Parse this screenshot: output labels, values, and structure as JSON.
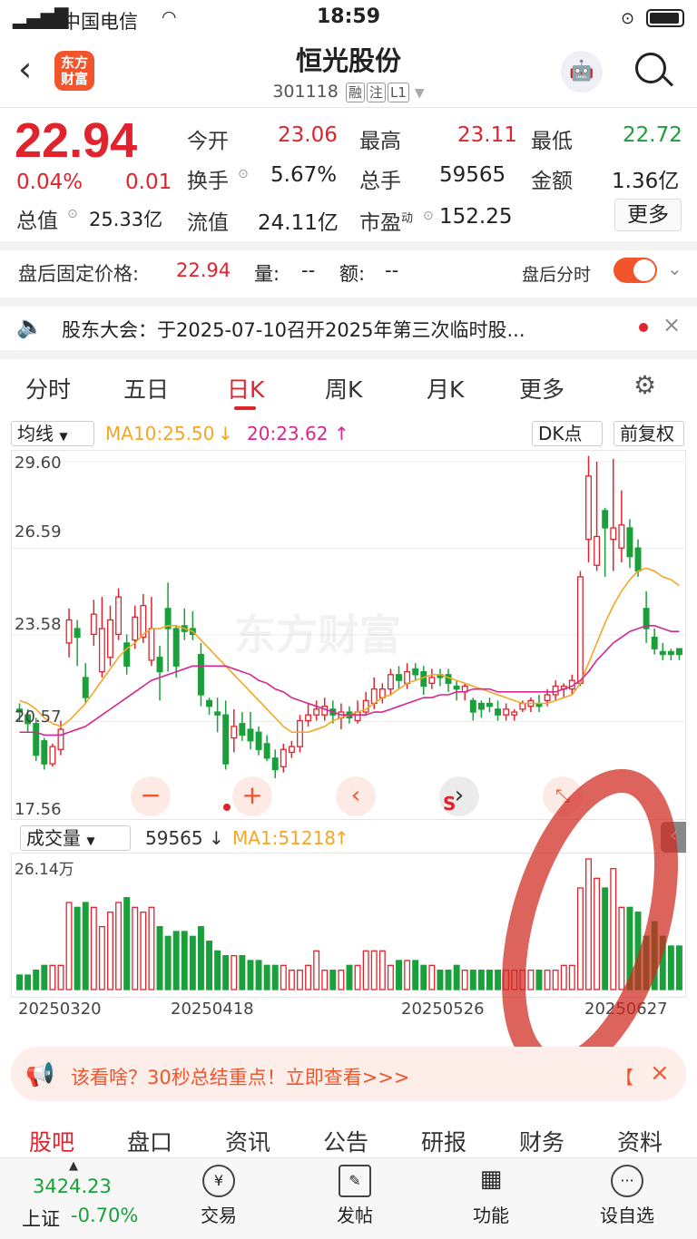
{
  "status": {
    "carrier": "中国电信",
    "time": "18:59"
  },
  "header": {
    "title": "恒光股份",
    "code": "301118",
    "tags": [
      "融",
      "注",
      "L1"
    ],
    "logo_text": "东方财富"
  },
  "quote": {
    "price": "22.94",
    "change_pct": "0.04%",
    "change": "0.01",
    "open_label": "今开",
    "open": "23.06",
    "high_label": "最高",
    "high": "23.11",
    "low_label": "最低",
    "low": "22.72",
    "turnover_label": "换手",
    "turnover": "5.67%",
    "volume_label": "总手",
    "volume": "59565",
    "amount_label": "金额",
    "amount": "1.36亿",
    "total_value_label": "总值",
    "total_value": "25.33亿",
    "float_value_label": "流值",
    "float_value": "24.11亿",
    "pe_label": "市盈",
    "pe_sup": "动",
    "pe": "152.25",
    "more_label": "更多"
  },
  "after_hours": {
    "label": "盘后固定价格:",
    "price": "22.94",
    "vol_label": "量:",
    "vol": "--",
    "amt_label": "额:",
    "amt": "--",
    "switch_label": "盘后分时",
    "switch_on": true
  },
  "notice": {
    "text": "股东大会：于2025-07-10召开2025年第三次临时股..."
  },
  "tabs": [
    {
      "label": "分时"
    },
    {
      "label": "五日"
    },
    {
      "label": "日K",
      "active": true
    },
    {
      "label": "周K"
    },
    {
      "label": "月K"
    },
    {
      "label": "更多"
    }
  ],
  "kline": {
    "ma_select": "均线",
    "ma10": "MA10:25.50",
    "ma20": "20:23.62",
    "dk_label": "DK点",
    "fq_label": "前复权",
    "y_ticks": [
      "29.60",
      "26.59",
      "23.58",
      "20.57",
      "17.56"
    ],
    "watermark": "东方财富",
    "vol_select": "成交量",
    "vol_value": "59565",
    "vol_ma": "MA1:51218",
    "vol_max": "26.14万",
    "x_ticks": [
      "20250320",
      "20250418",
      "20250526",
      "20250627"
    ]
  },
  "chart_data": {
    "type": "candlestick",
    "ylim": [
      17.56,
      29.6
    ],
    "candles": [
      [
        21.0,
        20.9,
        21.2,
        20.6
      ],
      [
        20.8,
        20.5,
        21.0,
        20.2
      ],
      [
        20.5,
        19.4,
        20.7,
        19.2
      ],
      [
        19.9,
        19.1,
        20.0,
        18.9
      ],
      [
        19.1,
        19.7,
        19.8,
        19.0
      ],
      [
        19.6,
        20.3,
        20.6,
        19.4
      ],
      [
        23.3,
        24.1,
        24.5,
        22.8
      ],
      [
        23.8,
        23.5,
        24.1,
        22.5
      ],
      [
        22.1,
        21.4,
        22.6,
        21.2
      ],
      [
        23.6,
        24.3,
        24.8,
        23.2
      ],
      [
        22.3,
        23.8,
        24.9,
        22.1
      ],
      [
        22.8,
        24.1,
        24.6,
        22.5
      ],
      [
        23.6,
        24.9,
        25.2,
        23.4
      ],
      [
        23.3,
        22.5,
        23.6,
        22.2
      ],
      [
        23.4,
        24.2,
        24.6,
        23.1
      ],
      [
        23.5,
        24.6,
        25.0,
        23.3
      ],
      [
        22.7,
        23.8,
        24.9,
        22.5
      ],
      [
        22.8,
        22.3,
        23.2,
        21.3
      ],
      [
        24.5,
        23.8,
        25.4,
        22.3
      ],
      [
        23.8,
        22.5,
        23.9,
        22.1
      ],
      [
        23.9,
        23.7,
        24.5,
        23.4
      ],
      [
        23.8,
        23.6,
        24.4,
        23.4
      ],
      [
        22.9,
        21.5,
        23.3,
        21.1
      ],
      [
        21.3,
        21.1,
        21.4,
        20.8
      ],
      [
        20.9,
        20.8,
        21.4,
        20.2
      ],
      [
        20.8,
        19.1,
        21.3,
        18.9
      ],
      [
        20.0,
        20.4,
        21.0,
        19.5
      ],
      [
        20.5,
        20.1,
        20.9,
        19.9
      ],
      [
        20.3,
        19.9,
        20.9,
        19.6
      ],
      [
        20.2,
        19.6,
        20.4,
        19.4
      ],
      [
        19.8,
        19.3,
        20.1,
        19.2
      ],
      [
        19.3,
        18.9,
        19.6,
        18.6
      ],
      [
        19.0,
        19.6,
        19.8,
        18.8
      ],
      [
        19.5,
        19.7,
        19.9,
        19.3
      ],
      [
        19.7,
        20.6,
        20.8,
        19.5
      ],
      [
        20.6,
        20.8,
        21.2,
        20.4
      ],
      [
        20.8,
        21.0,
        21.3,
        20.6
      ],
      [
        20.8,
        21.1,
        21.4,
        20.6
      ],
      [
        21.0,
        20.8,
        21.3,
        20.5
      ],
      [
        20.7,
        20.9,
        21.2,
        20.3
      ],
      [
        20.9,
        20.7,
        21.1,
        20.5
      ],
      [
        20.6,
        20.9,
        21.3,
        20.5
      ],
      [
        20.9,
        21.3,
        21.6,
        20.8
      ],
      [
        21.2,
        21.7,
        22.1,
        21.0
      ],
      [
        21.4,
        21.7,
        21.9,
        21.2
      ],
      [
        21.7,
        22.2,
        22.4,
        21.5
      ],
      [
        22.2,
        22.0,
        22.5,
        21.7
      ],
      [
        21.9,
        22.3,
        22.6,
        21.7
      ],
      [
        22.4,
        22.2,
        22.6,
        22.0
      ],
      [
        22.3,
        21.8,
        22.5,
        21.5
      ],
      [
        21.9,
        22.1,
        22.4,
        21.7
      ],
      [
        22.2,
        22.1,
        22.4,
        21.8
      ],
      [
        22.2,
        21.9,
        22.4,
        21.6
      ],
      [
        21.8,
        21.7,
        22.0,
        21.3
      ],
      [
        21.6,
        21.8,
        21.9,
        21.3
      ],
      [
        21.3,
        20.9,
        21.4,
        20.6
      ],
      [
        21.2,
        21.0,
        21.3,
        20.7
      ],
      [
        21.2,
        21.1,
        21.4,
        20.9
      ],
      [
        21.0,
        20.8,
        21.3,
        20.6
      ],
      [
        20.8,
        21.0,
        21.2,
        20.6
      ],
      [
        20.8,
        20.9,
        21.0,
        20.6
      ],
      [
        21.0,
        21.2,
        21.3,
        20.9
      ],
      [
        21.1,
        21.3,
        21.4,
        20.9
      ],
      [
        21.2,
        21.1,
        21.5,
        20.9
      ],
      [
        21.3,
        21.5,
        21.7,
        21.1
      ],
      [
        21.5,
        21.8,
        22.0,
        21.3
      ],
      [
        21.7,
        21.8,
        21.9,
        21.4
      ],
      [
        21.7,
        22.0,
        22.2,
        21.5
      ],
      [
        21.9,
        25.6,
        25.8,
        21.8
      ],
      [
        26.9,
        29.1,
        29.8,
        26.1
      ],
      [
        26.0,
        27.0,
        29.6,
        25.8
      ],
      [
        27.9,
        27.3,
        28.0,
        25.6
      ],
      [
        26.9,
        27.3,
        29.7,
        25.8
      ],
      [
        26.6,
        27.4,
        28.6,
        26.1
      ],
      [
        27.3,
        26.3,
        27.6,
        25.9
      ],
      [
        26.6,
        25.8,
        26.9,
        25.6
      ],
      [
        24.5,
        23.8,
        25.1,
        23.3
      ],
      [
        23.5,
        23.1,
        23.8,
        22.9
      ],
      [
        23.0,
        22.9,
        23.3,
        22.7
      ],
      [
        23.0,
        22.9,
        23.1,
        22.7
      ],
      [
        23.1,
        22.9,
        23.1,
        22.7
      ]
    ],
    "ma10": [
      21.3,
      21.2,
      21.0,
      20.7,
      20.5,
      20.4,
      20.6,
      20.9,
      21.2,
      21.6,
      22.0,
      22.4,
      22.8,
      23.1,
      23.3,
      23.6,
      23.8,
      23.8,
      23.9,
      23.9,
      23.8,
      23.7,
      23.4,
      23.1,
      22.8,
      22.5,
      22.2,
      21.9,
      21.6,
      21.3,
      21.0,
      20.7,
      20.4,
      20.2,
      20.2,
      20.2,
      20.3,
      20.4,
      20.6,
      20.7,
      20.8,
      20.9,
      21.0,
      21.2,
      21.4,
      21.5,
      21.7,
      21.9,
      22.0,
      22.1,
      22.2,
      22.2,
      22.1,
      22.0,
      21.9,
      21.8,
      21.7,
      21.6,
      21.5,
      21.4,
      21.3,
      21.2,
      21.2,
      21.2,
      21.2,
      21.3,
      21.4,
      21.5,
      21.9,
      22.6,
      23.3,
      24.0,
      24.6,
      25.1,
      25.5,
      25.8,
      25.9,
      25.8,
      25.6,
      25.5,
      25.3
    ],
    "ma20": [
      20.2,
      20.2,
      20.2,
      20.1,
      20.1,
      20.1,
      20.2,
      20.3,
      20.4,
      20.6,
      20.8,
      21.0,
      21.2,
      21.4,
      21.6,
      21.8,
      22.0,
      22.1,
      22.2,
      22.3,
      22.4,
      22.5,
      22.5,
      22.5,
      22.5,
      22.5,
      22.4,
      22.3,
      22.2,
      22.0,
      21.9,
      21.7,
      21.6,
      21.4,
      21.3,
      21.2,
      21.1,
      21.0,
      20.9,
      20.8,
      20.8,
      20.8,
      20.8,
      20.9,
      20.9,
      21.0,
      21.1,
      21.2,
      21.3,
      21.4,
      21.4,
      21.5,
      21.5,
      21.6,
      21.6,
      21.7,
      21.7,
      21.7,
      21.6,
      21.6,
      21.6,
      21.6,
      21.6,
      21.6,
      21.6,
      21.6,
      21.7,
      21.8,
      22.0,
      22.3,
      22.7,
      23.0,
      23.3,
      23.5,
      23.7,
      23.8,
      23.9,
      23.9,
      23.8,
      23.7,
      23.7
    ],
    "volumes": [
      3,
      3,
      4,
      5,
      5,
      5,
      18,
      17,
      18,
      17,
      13,
      16,
      18,
      19,
      17,
      16,
      17,
      13,
      11,
      12,
      12,
      11,
      13,
      10,
      8,
      7,
      7,
      7,
      6,
      6,
      5,
      5,
      5,
      4,
      4,
      5,
      8,
      4,
      4,
      4,
      5,
      5,
      8,
      8,
      8,
      5,
      6,
      6,
      6,
      5,
      5,
      4,
      4,
      5,
      4,
      4,
      4,
      4,
      4,
      4,
      4,
      4,
      4,
      4,
      4,
      4,
      5,
      5,
      21,
      27,
      23,
      21,
      25,
      17,
      17,
      16,
      11,
      14,
      11,
      9,
      9
    ]
  },
  "banner": {
    "text": "该看啥？30秒总结重点！立即查看>>>"
  },
  "bottom_tabs": [
    {
      "label": "股吧",
      "active": true
    },
    {
      "label": "盘口"
    },
    {
      "label": "资讯"
    },
    {
      "label": "公告"
    },
    {
      "label": "研报"
    },
    {
      "label": "财务"
    },
    {
      "label": "资料"
    }
  ],
  "nav": {
    "index_value": "3424.23",
    "index_name": "上证",
    "index_change": "-0.70%",
    "items": [
      {
        "label": "交易",
        "icon": "¥"
      },
      {
        "label": "发帖",
        "icon": "✎"
      },
      {
        "label": "功能",
        "icon": "▦"
      },
      {
        "label": "设自选",
        "icon": "···"
      }
    ]
  },
  "colors": {
    "up": "#e0242e",
    "down": "#1aa03a",
    "ma10": "#f5a623",
    "ma20": "#d6268f",
    "accent": "#f2552c"
  }
}
